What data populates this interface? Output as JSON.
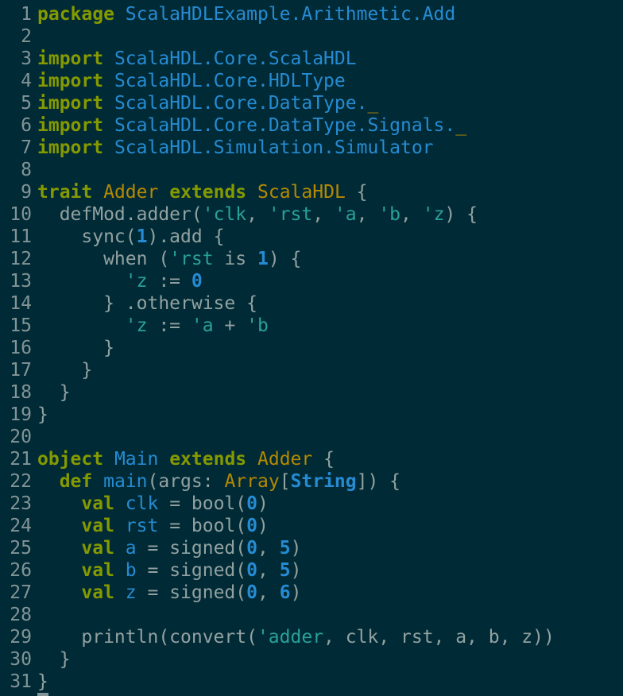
{
  "editor": {
    "colors": {
      "background": "#002b36",
      "line_number": "#839496",
      "plain": "#93a1a1",
      "keyword": "#859900",
      "identifier": "#268bd2",
      "symbol": "#2aa198",
      "number": "#268bd2",
      "class_name": "#b58900"
    },
    "lines": [
      {
        "n": "1",
        "tokens": [
          [
            "keyword",
            "package"
          ],
          [
            "plain",
            " "
          ],
          [
            "ident",
            "ScalaHDLExample.Arithmetic.Add"
          ]
        ]
      },
      {
        "n": "2",
        "tokens": []
      },
      {
        "n": "3",
        "tokens": [
          [
            "keyword",
            "import"
          ],
          [
            "plain",
            " "
          ],
          [
            "ident",
            "ScalaHDL.Core.ScalaHDL"
          ]
        ]
      },
      {
        "n": "4",
        "tokens": [
          [
            "keyword",
            "import"
          ],
          [
            "plain",
            " "
          ],
          [
            "ident",
            "ScalaHDL.Core.HDLType"
          ]
        ]
      },
      {
        "n": "5",
        "tokens": [
          [
            "keyword",
            "import"
          ],
          [
            "plain",
            " "
          ],
          [
            "ident",
            "ScalaHDL.Core.DataType."
          ],
          [
            "cursor",
            "_"
          ]
        ]
      },
      {
        "n": "6",
        "tokens": [
          [
            "keyword",
            "import"
          ],
          [
            "plain",
            " "
          ],
          [
            "ident",
            "ScalaHDL.Core.DataType.Signals."
          ],
          [
            "cursor",
            "_"
          ]
        ]
      },
      {
        "n": "7",
        "tokens": [
          [
            "keyword",
            "import"
          ],
          [
            "plain",
            " "
          ],
          [
            "ident",
            "ScalaHDL.Simulation.Simulator"
          ]
        ]
      },
      {
        "n": "8",
        "tokens": []
      },
      {
        "n": "9",
        "tokens": [
          [
            "keyword",
            "trait"
          ],
          [
            "plain",
            " "
          ],
          [
            "class",
            "Adder"
          ],
          [
            "plain",
            " "
          ],
          [
            "keyword",
            "extends"
          ],
          [
            "plain",
            " "
          ],
          [
            "class",
            "ScalaHDL"
          ],
          [
            "plain",
            " {"
          ]
        ]
      },
      {
        "n": "10",
        "tokens": [
          [
            "plain",
            "  defMod.adder("
          ],
          [
            "symbol",
            "'clk"
          ],
          [
            "plain",
            ", "
          ],
          [
            "symbol",
            "'rst"
          ],
          [
            "plain",
            ", "
          ],
          [
            "symbol",
            "'a"
          ],
          [
            "plain",
            ", "
          ],
          [
            "symbol",
            "'b"
          ],
          [
            "plain",
            ", "
          ],
          [
            "symbol",
            "'z"
          ],
          [
            "plain",
            ") {"
          ]
        ]
      },
      {
        "n": "11",
        "tokens": [
          [
            "plain",
            "    sync("
          ],
          [
            "number",
            "1"
          ],
          [
            "plain",
            ").add {"
          ]
        ]
      },
      {
        "n": "12",
        "tokens": [
          [
            "plain",
            "      when ("
          ],
          [
            "symbol",
            "'rst"
          ],
          [
            "plain",
            " is "
          ],
          [
            "number",
            "1"
          ],
          [
            "plain",
            ") {"
          ]
        ]
      },
      {
        "n": "13",
        "tokens": [
          [
            "plain",
            "        "
          ],
          [
            "symbol",
            "'z"
          ],
          [
            "plain",
            " := "
          ],
          [
            "number",
            "0"
          ]
        ]
      },
      {
        "n": "14",
        "tokens": [
          [
            "plain",
            "      } .otherwise {"
          ]
        ]
      },
      {
        "n": "15",
        "tokens": [
          [
            "plain",
            "        "
          ],
          [
            "symbol",
            "'z"
          ],
          [
            "plain",
            " := "
          ],
          [
            "symbol",
            "'a"
          ],
          [
            "plain",
            " + "
          ],
          [
            "symbol",
            "'b"
          ]
        ]
      },
      {
        "n": "16",
        "tokens": [
          [
            "plain",
            "      }"
          ]
        ]
      },
      {
        "n": "17",
        "tokens": [
          [
            "plain",
            "    }"
          ]
        ]
      },
      {
        "n": "18",
        "tokens": [
          [
            "plain",
            "  }"
          ]
        ]
      },
      {
        "n": "19",
        "tokens": [
          [
            "plain",
            "}"
          ]
        ]
      },
      {
        "n": "20",
        "tokens": []
      },
      {
        "n": "21",
        "tokens": [
          [
            "keyword",
            "object"
          ],
          [
            "plain",
            " "
          ],
          [
            "ident",
            "Main"
          ],
          [
            "plain",
            " "
          ],
          [
            "keyword",
            "extends"
          ],
          [
            "plain",
            " "
          ],
          [
            "class",
            "Adder"
          ],
          [
            "plain",
            " {"
          ]
        ]
      },
      {
        "n": "22",
        "tokens": [
          [
            "plain",
            "  "
          ],
          [
            "keyword",
            "def"
          ],
          [
            "plain",
            " "
          ],
          [
            "ident",
            "main"
          ],
          [
            "plain",
            "(args: "
          ],
          [
            "class",
            "Array"
          ],
          [
            "plain",
            "["
          ],
          [
            "type",
            "String"
          ],
          [
            "plain",
            "]) {"
          ]
        ]
      },
      {
        "n": "23",
        "tokens": [
          [
            "plain",
            "    "
          ],
          [
            "keyword",
            "val"
          ],
          [
            "plain",
            " "
          ],
          [
            "ident",
            "clk"
          ],
          [
            "plain",
            " = bool("
          ],
          [
            "number",
            "0"
          ],
          [
            "plain",
            ")"
          ]
        ]
      },
      {
        "n": "24",
        "tokens": [
          [
            "plain",
            "    "
          ],
          [
            "keyword",
            "val"
          ],
          [
            "plain",
            " "
          ],
          [
            "ident",
            "rst"
          ],
          [
            "plain",
            " = bool("
          ],
          [
            "number",
            "0"
          ],
          [
            "plain",
            ")"
          ]
        ]
      },
      {
        "n": "25",
        "tokens": [
          [
            "plain",
            "    "
          ],
          [
            "keyword",
            "val"
          ],
          [
            "plain",
            " "
          ],
          [
            "ident",
            "a"
          ],
          [
            "plain",
            " = signed("
          ],
          [
            "number",
            "0"
          ],
          [
            "plain",
            ", "
          ],
          [
            "number",
            "5"
          ],
          [
            "plain",
            ")"
          ]
        ]
      },
      {
        "n": "26",
        "tokens": [
          [
            "plain",
            "    "
          ],
          [
            "keyword",
            "val"
          ],
          [
            "plain",
            " "
          ],
          [
            "ident",
            "b"
          ],
          [
            "plain",
            " = signed("
          ],
          [
            "number",
            "0"
          ],
          [
            "plain",
            ", "
          ],
          [
            "number",
            "5"
          ],
          [
            "plain",
            ")"
          ]
        ]
      },
      {
        "n": "27",
        "tokens": [
          [
            "plain",
            "    "
          ],
          [
            "keyword",
            "val"
          ],
          [
            "plain",
            " "
          ],
          [
            "ident",
            "z"
          ],
          [
            "plain",
            " = signed("
          ],
          [
            "number",
            "0"
          ],
          [
            "plain",
            ", "
          ],
          [
            "number",
            "6"
          ],
          [
            "plain",
            ")"
          ]
        ]
      },
      {
        "n": "28",
        "tokens": []
      },
      {
        "n": "29",
        "tokens": [
          [
            "plain",
            "    println(convert("
          ],
          [
            "symbol",
            "'adder"
          ],
          [
            "plain",
            ", clk, rst, a, b, z))"
          ]
        ]
      },
      {
        "n": "30",
        "tokens": [
          [
            "plain",
            "  }"
          ]
        ]
      },
      {
        "n": "31",
        "tokens": [
          [
            "plain",
            "}"
          ]
        ]
      }
    ]
  }
}
